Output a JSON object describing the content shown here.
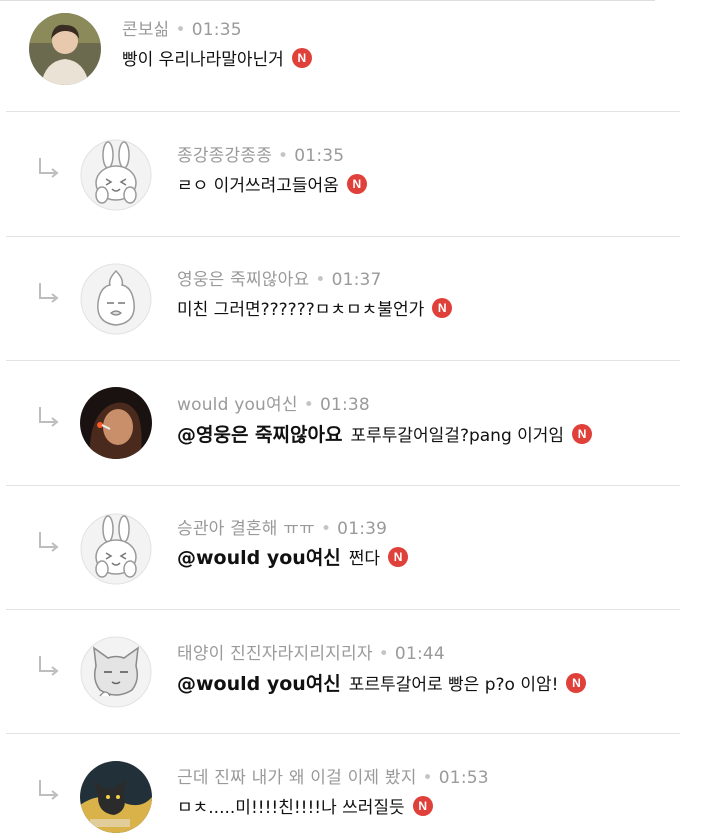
{
  "comments": [
    {
      "author": "콘보싦",
      "time": "01:35",
      "mention": "",
      "text": "빵이 우리나라말아닌거",
      "badge": "N",
      "reply": false,
      "avatar": "profile-photo"
    },
    {
      "author": "종강종강종종",
      "time": "01:35",
      "mention": "",
      "text": "ㄹㅇ 이거쓰려고들어옴",
      "badge": "N",
      "reply": true,
      "avatar": "bunny-character"
    },
    {
      "author": "영웅은 죽찌않아요",
      "time": "01:37",
      "mention": "",
      "text": "미친 그러면??????ㅁㅊㅁㅊ불언가",
      "badge": "N",
      "reply": true,
      "avatar": "peach-character"
    },
    {
      "author": "would you여신",
      "time": "01:38",
      "mention": "@영웅은 죽찌않아요",
      "text": "포루투갈어일걸?pang 이거임",
      "badge": "N",
      "reply": true,
      "avatar": "profile-photo"
    },
    {
      "author": "승관아 결혼해 ㅠㅠ",
      "time": "01:39",
      "mention": "@would you여신",
      "text": "쩐다",
      "badge": "N",
      "reply": true,
      "avatar": "bunny-character"
    },
    {
      "author": "태양이 진진자라지리지리자",
      "time": "01:44",
      "mention": "@would you여신",
      "text": "포르투갈어로 빵은 p?o 이암!",
      "badge": "N",
      "reply": true,
      "avatar": "cat-character"
    },
    {
      "author": "근데 진짜 내가 왜 이걸 이제 봤지",
      "time": "01:53",
      "mention": "",
      "text": "ㅁㅊ.....미!!!!친!!!!나 쓰러질듯",
      "badge": "N",
      "reply": true,
      "avatar": "profile-photo"
    }
  ]
}
